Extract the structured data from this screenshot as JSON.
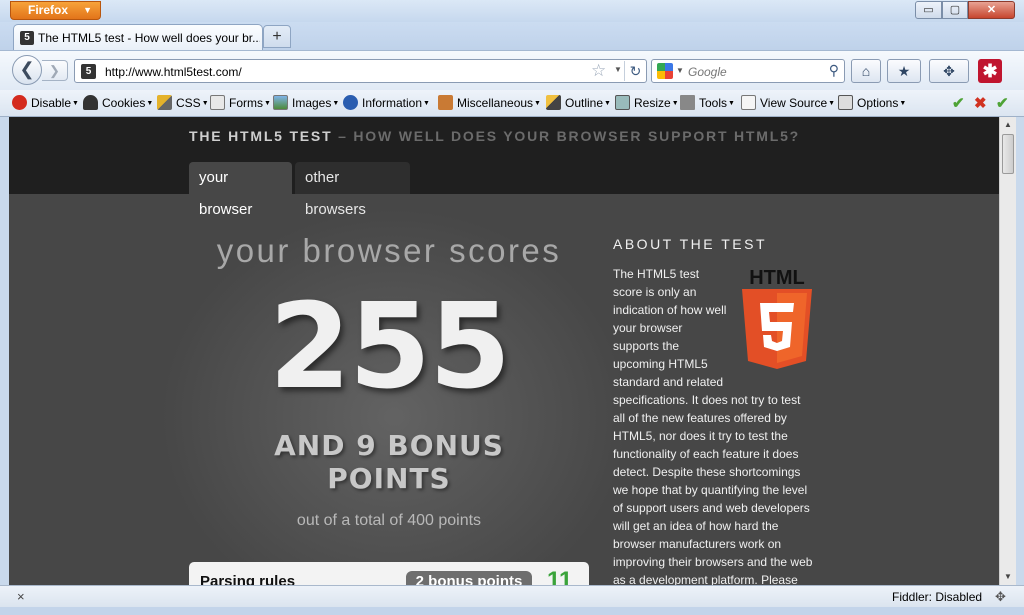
{
  "window": {
    "app_button": "Firefox",
    "controls": {
      "minimize": "▭",
      "maximize": "▢",
      "close": "✕"
    }
  },
  "tab": {
    "title": "The HTML5 test - How well does your br...",
    "favicon": "5",
    "new_tab": "+"
  },
  "navbar": {
    "url": "http://www.html5test.com/",
    "search_placeholder": "Google",
    "back": "❮",
    "forward": "❯",
    "reload": "↻",
    "star": "☆"
  },
  "webdev_toolbar": {
    "items": [
      {
        "label": "Disable",
        "icon": "disable-icon"
      },
      {
        "label": "Cookies",
        "icon": "cookies-icon"
      },
      {
        "label": "CSS",
        "icon": "css-icon"
      },
      {
        "label": "Forms",
        "icon": "forms-icon"
      },
      {
        "label": "Images",
        "icon": "images-icon"
      },
      {
        "label": "Information",
        "icon": "information-icon"
      },
      {
        "label": "Miscellaneous",
        "icon": "miscellaneous-icon"
      },
      {
        "label": "Outline",
        "icon": "outline-icon"
      },
      {
        "label": "Resize",
        "icon": "resize-icon"
      },
      {
        "label": "Tools",
        "icon": "tools-icon"
      },
      {
        "label": "View Source",
        "icon": "view-source-icon"
      },
      {
        "label": "Options",
        "icon": "options-icon"
      }
    ],
    "status_glyphs": [
      "✔",
      "✖",
      "✔"
    ]
  },
  "page": {
    "site_title_main": "THE HTML5 TEST",
    "site_title_sub": " – HOW WELL DOES YOUR BROWSER SUPPORT HTML5?",
    "tabs": [
      "your browser",
      "other browsers"
    ],
    "scores_heading": "your browser scores",
    "score": "255",
    "bonus_line1": "AND 9 BONUS",
    "bonus_line2": "POINTS",
    "out_of": "out of a total of 400 points",
    "card": {
      "label": "Parsing rules",
      "pill": "2 bonus points",
      "number": "11"
    },
    "about_heading": "ABOUT THE TEST",
    "about_lines": [
      "The HTML5 test",
      "score is only an",
      "indication of how well",
      "your browser",
      "supports the",
      "upcoming HTML5",
      "standard and related",
      "specifications. It does not try to test",
      "all of the new features offered by",
      "HTML5, nor does it try to test the",
      "functionality of each feature it does",
      "detect. Despite these shortcomings",
      "we hope that by quantifying the level",
      "of support users and web developers",
      "will get an idea of how hard the",
      "browser manufacturers work on",
      "improving their browsers and the web",
      "as a development platform. Please"
    ],
    "logo_text": "HTML",
    "logo_number": "5"
  },
  "statusbar": {
    "close": "×",
    "fiddler": "Fiddler: Disabled"
  },
  "colors": {
    "page_bg": "#474747",
    "header_bg": "#1f1f1f",
    "logo_orange": "#e34f26",
    "accent_green": "#3aa33a"
  }
}
